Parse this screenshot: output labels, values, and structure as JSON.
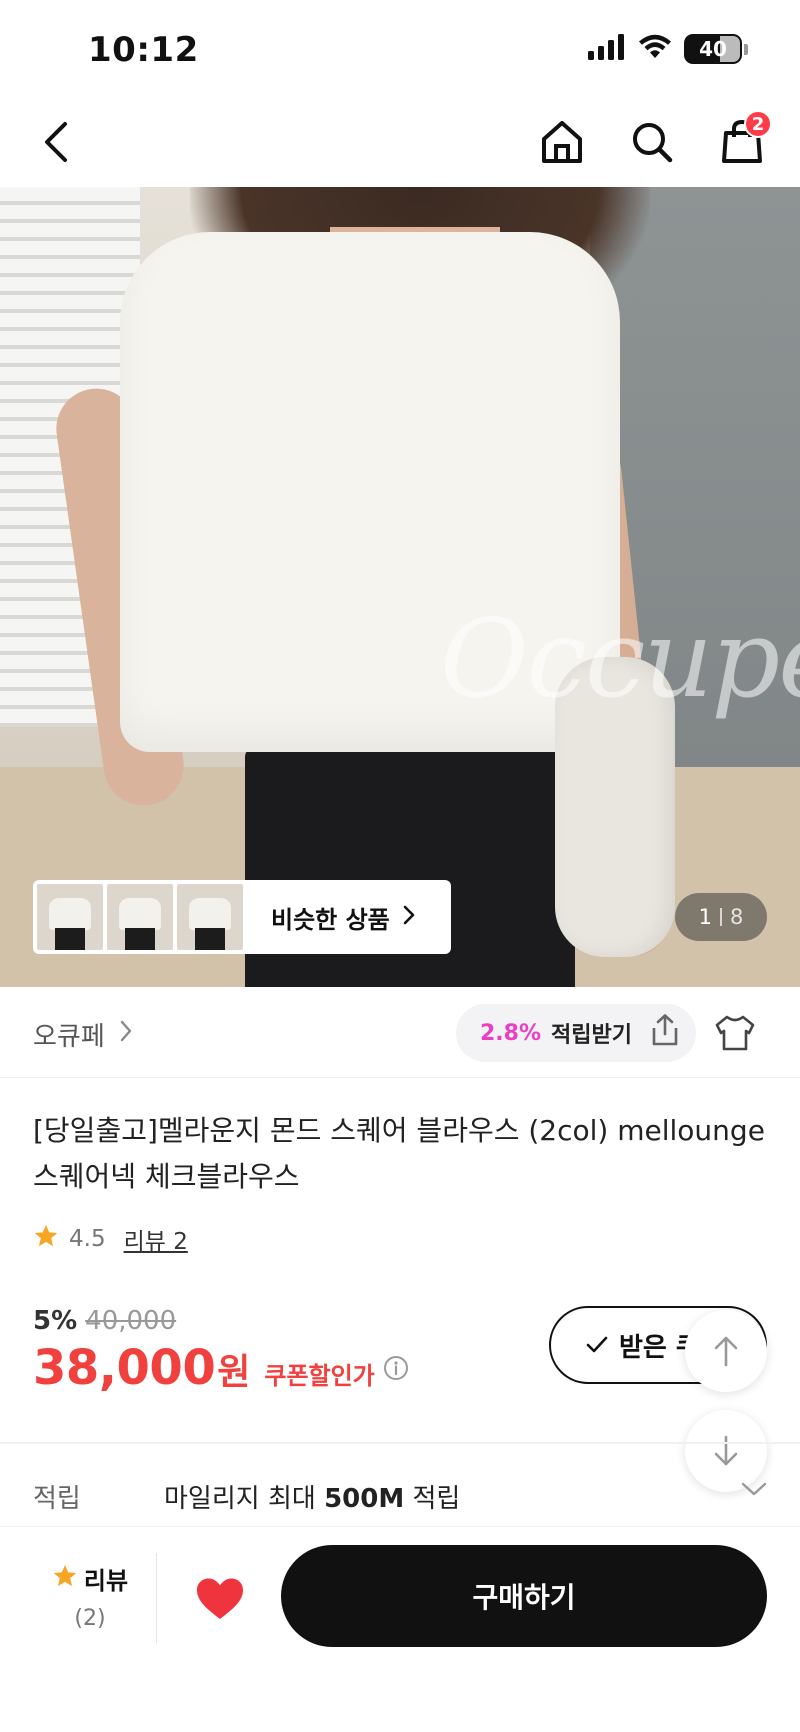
{
  "status_bar": {
    "time": "10:12",
    "battery": "40"
  },
  "nav": {
    "cart_count": "2"
  },
  "gallery": {
    "watermark": "Occupé",
    "similar_label": "비슷한 상품",
    "current_page": "1",
    "total_pages": "8"
  },
  "brand": {
    "name": "오큐페",
    "points_percent": "2.8%",
    "points_label": "적립받기"
  },
  "product": {
    "title": "[당일출고]멜라운지 몬드 스퀘어 블라우스 (2col) mellounge 스퀘어넥 체크블라우스",
    "rating": "4.5",
    "reviews_label": "리뷰 2",
    "discount_percent": "5%",
    "original_price": "40,000",
    "price": "38,000",
    "currency": "원",
    "coupon_price_label": "쿠폰할인가",
    "coupon_button_label": "받은 쿠"
  },
  "mileage": {
    "label": "적립",
    "text_prefix": "마일리지 최대 ",
    "text_amount": "500M",
    "text_suffix": " 적립"
  },
  "bottom_bar": {
    "review_label": "리뷰",
    "review_count": "(2)",
    "buy_label": "구매하기"
  },
  "colors": {
    "price_red": "#f0413e",
    "points_pink": "#ea3fc4",
    "heart_red": "#f0343e",
    "star_orange": "#f6a623",
    "badge_red": "#ff3b4a"
  }
}
